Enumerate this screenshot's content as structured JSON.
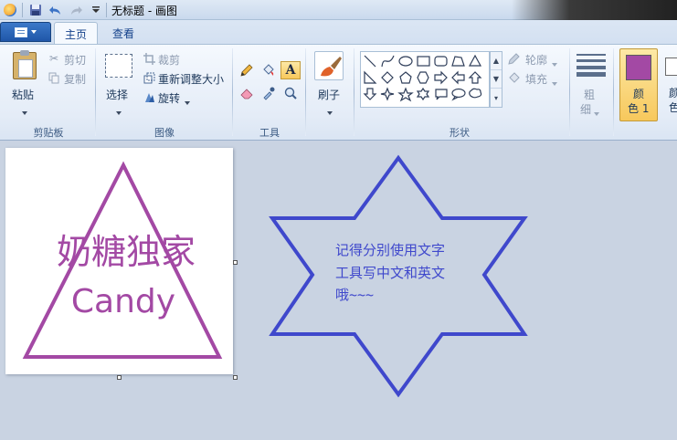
{
  "window": {
    "title": "无标题 - 画图"
  },
  "tabs": {
    "file_menu": "",
    "home": "主页",
    "view": "查看"
  },
  "clipboard": {
    "paste": "粘贴",
    "cut": "剪切",
    "copy": "复制",
    "group": "剪贴板"
  },
  "image": {
    "select": "选择",
    "crop": "裁剪",
    "resize": "重新调整大小",
    "rotate": "旋转",
    "group": "图像"
  },
  "tools": {
    "group": "工具",
    "text_glyph": "A"
  },
  "brushes": {
    "label": "刷子"
  },
  "shapes": {
    "outline": "轮廓",
    "fill": "填充",
    "group": "形状"
  },
  "size": {
    "label_line1": "粗",
    "label_line2": "细"
  },
  "colors": {
    "color1_line1": "颜",
    "color1_line2": "色 1",
    "color2_line1": "颜",
    "color2_line2": "色",
    "color1_value": "#a349a4",
    "color2_value": "#ffffff"
  },
  "canvas": {
    "text_chinese": "奶糖独家",
    "text_english": "Candy",
    "star_text_line1": "记得分别使用文字",
    "star_text_line2": "工具写中文和英文",
    "star_text_line3": "哦~~~",
    "triangle_color": "#a349a4",
    "star_color": "#3f48cc"
  }
}
